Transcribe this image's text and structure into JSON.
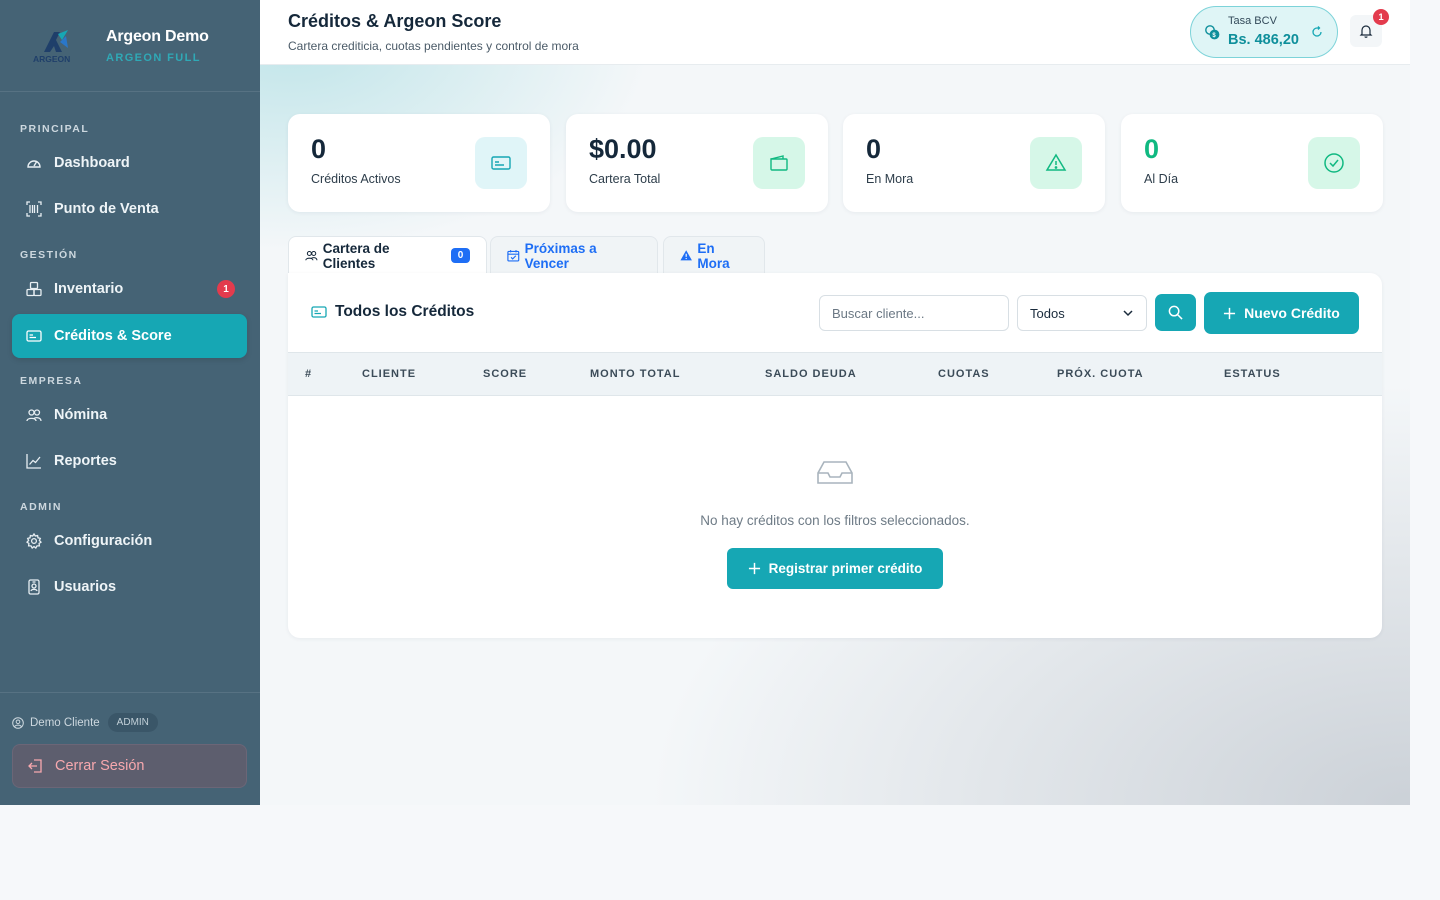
{
  "brand": {
    "name": "Argeon Demo",
    "plan": "ARGEON FULL",
    "logo_text": "ARGEON"
  },
  "sidebar": {
    "sections": [
      "PRINCIPAL",
      "GESTIÓN",
      "EMPRESA",
      "ADMIN"
    ],
    "items": [
      {
        "label": "Dashboard",
        "icon": "gauge-icon"
      },
      {
        "label": "Punto de Venta",
        "icon": "barcode-icon"
      },
      {
        "label": "Inventario",
        "icon": "boxes-icon",
        "badge": "1"
      },
      {
        "label": "Créditos & Score",
        "icon": "credit-card-icon",
        "active": true
      },
      {
        "label": "Nómina",
        "icon": "people-icon"
      },
      {
        "label": "Reportes",
        "icon": "chart-line-icon"
      },
      {
        "label": "Configuración",
        "icon": "gear-icon"
      },
      {
        "label": "Usuarios",
        "icon": "person-badge-icon"
      }
    ],
    "user": {
      "name": "Demo Cliente",
      "role": "ADMIN"
    },
    "logout_label": "Cerrar Sesión"
  },
  "header": {
    "title": "Créditos & Argeon Score",
    "subtitle": "Cartera crediticia, cuotas pendientes y control de mora",
    "rate_label": "Tasa BCV",
    "rate_value": "Bs. 486,20",
    "notification_count": "1"
  },
  "stats": [
    {
      "value": "0",
      "label": "Créditos Activos",
      "icon": "credit-card-icon",
      "color": "#0ea5b4"
    },
    {
      "value": "$0.00",
      "label": "Cartera Total",
      "icon": "wallet-icon",
      "color": "#10b981"
    },
    {
      "value": "0",
      "label": "En Mora",
      "icon": "warning-icon",
      "color": "#10b981"
    },
    {
      "value": "0",
      "label": "Al Día",
      "icon": "check-circle-icon",
      "color": "#10b981"
    }
  ],
  "tabs": [
    {
      "label": "Cartera de Clientes",
      "count": "0",
      "icon": "people-icon"
    },
    {
      "label": "Próximas a Vencer",
      "icon": "calendar-check-icon"
    },
    {
      "label": "En Mora",
      "icon": "warning-icon"
    }
  ],
  "panel": {
    "title": "Todos los Créditos",
    "search_placeholder": "Buscar cliente...",
    "filter_value": "Todos",
    "new_button": "Nuevo Crédito",
    "columns": [
      "#",
      "CLIENTE",
      "SCORE",
      "MONTO TOTAL",
      "SALDO DEUDA",
      "CUOTAS",
      "PRÓX. CUOTA",
      "ESTATUS"
    ],
    "empty_text": "No hay créditos con los filtros seleccionados.",
    "empty_button": "Registrar primer crédito"
  },
  "colors": {
    "accent": "#16a7b4",
    "sidebar": "#456375",
    "danger": "#e33b4d",
    "tab_link": "#1e6ef5",
    "success": "#10b981"
  }
}
